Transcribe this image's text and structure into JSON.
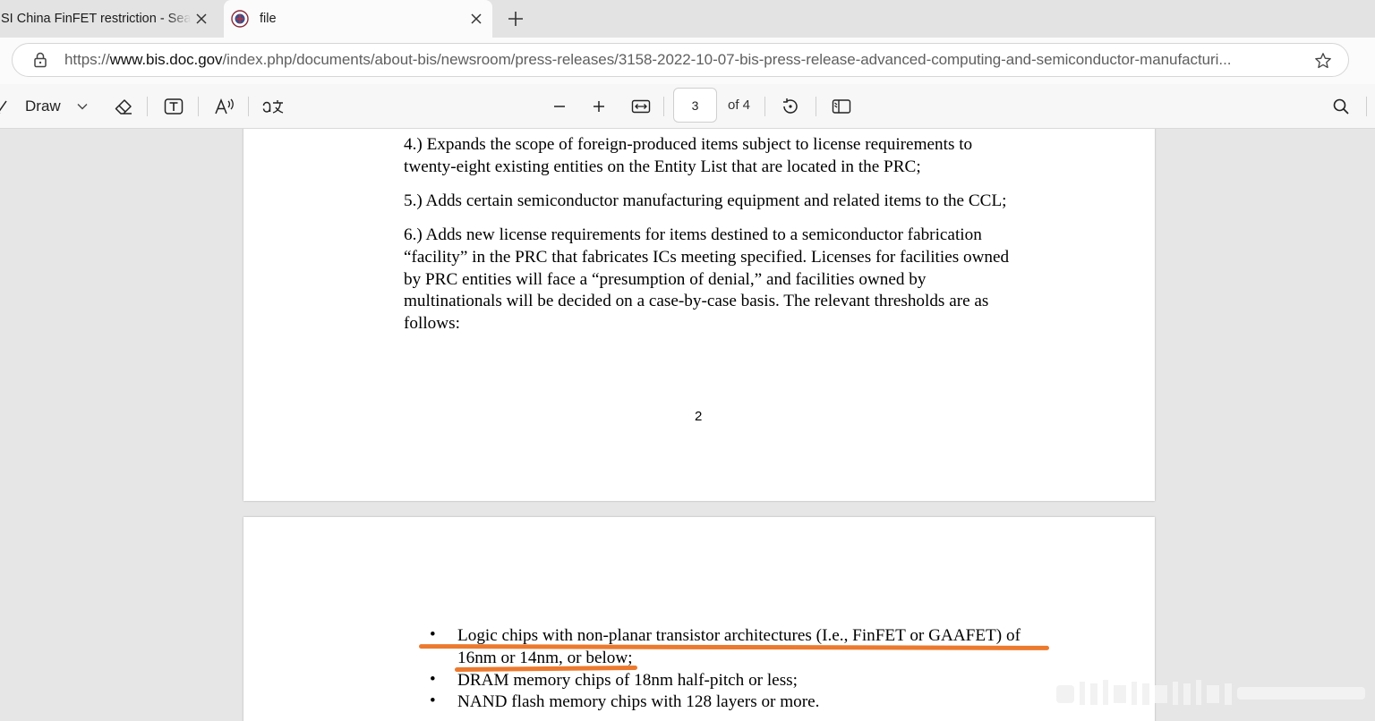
{
  "tabs": [
    {
      "title": "SI China FinFET restriction - Search",
      "active": false
    },
    {
      "title": "file",
      "active": true
    }
  ],
  "address_bar": {
    "scheme": "https://",
    "host": "www.bis.doc.gov",
    "path": "/index.php/documents/about-bis/newsroom/press-releases/3158-2022-10-07-bis-press-release-advanced-computing-and-semiconductor-manufacturi..."
  },
  "pdf_toolbar": {
    "draw_label": "Draw",
    "current_page": "3",
    "total_pages_label": "of 4"
  },
  "document": {
    "page_a": {
      "para4_line1": "4.) Expands the scope of foreign-produced items subject to license requirements to",
      "para4_line2": "twenty-eight existing entities on the Entity List that are located in the PRC;",
      "para5": "5.) Adds certain semiconductor manufacturing equipment and related items to the CCL;",
      "para6_line1": "6.) Adds new license requirements for items destined to a semiconductor fabrication",
      "para6_line2": "“facility” in the PRC that fabricates ICs meeting specified. Licenses for facilities owned",
      "para6_line3": "by PRC entities will face a “presumption of denial,” and facilities owned by",
      "para6_line4": "multinationals will be decided on a case-by-case basis. The relevant thresholds are as",
      "para6_line5": "follows:",
      "page_number": "2"
    },
    "page_b": {
      "bullet_symbol": "•",
      "bullet1_line1": "Logic chips with non-planar transistor architectures (I.e., FinFET or GAAFET) of",
      "bullet1_line2": "16nm or 14nm, or below;",
      "bullet2": "DRAM memory chips of 18nm half-pitch or less;",
      "bullet3": "NAND flash memory chips with 128 layers or more."
    }
  },
  "colors": {
    "highlight": "#ec7a2e",
    "tabstrip": "#e3e3e3",
    "doc_background": "#e6e6e6"
  }
}
